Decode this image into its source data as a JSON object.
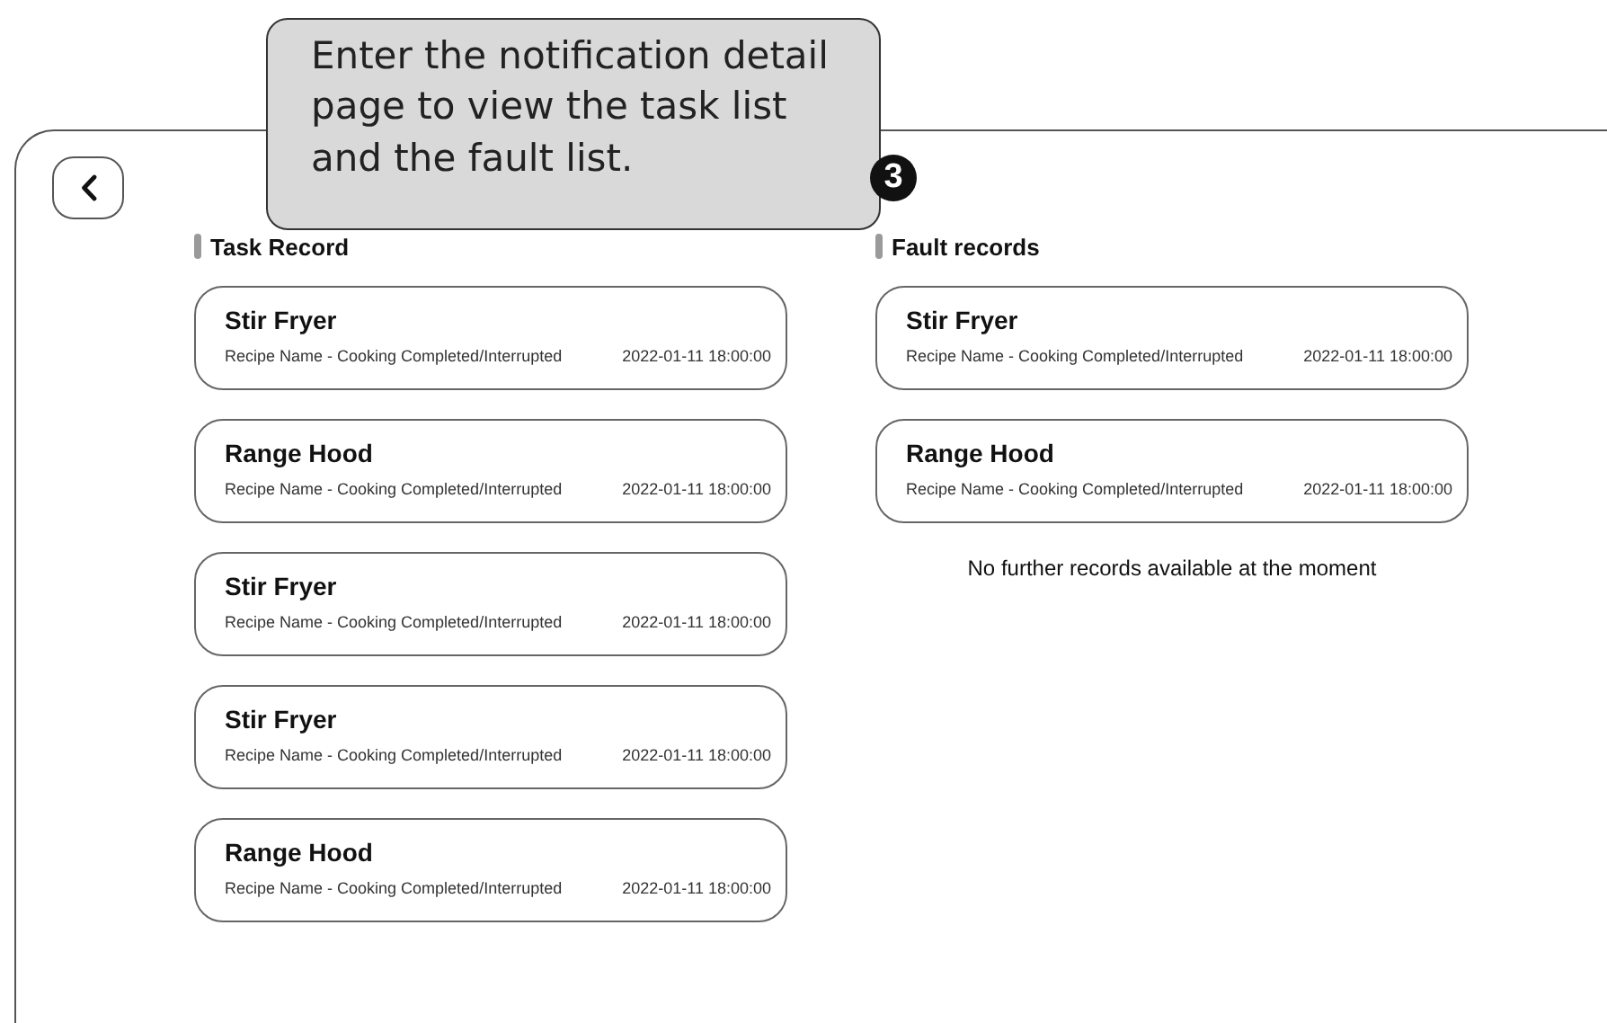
{
  "callout": {
    "text": "Enter the notification detail page to view the task list and the fault list.",
    "step": "3"
  },
  "task_record": {
    "title": "Task Record",
    "items": [
      {
        "title": "Stir Fryer",
        "subtitle": "Recipe Name - Cooking Completed/Interrupted",
        "time": "2022-01-11 18:00:00"
      },
      {
        "title": "Range Hood",
        "subtitle": "Recipe Name - Cooking Completed/Interrupted",
        "time": "2022-01-11 18:00:00"
      },
      {
        "title": "Stir Fryer",
        "subtitle": "Recipe Name - Cooking Completed/Interrupted",
        "time": "2022-01-11 18:00:00"
      },
      {
        "title": "Stir Fryer",
        "subtitle": "Recipe Name - Cooking Completed/Interrupted",
        "time": "2022-01-11 18:00:00"
      },
      {
        "title": "Range Hood",
        "subtitle": "Recipe Name - Cooking Completed/Interrupted",
        "time": "2022-01-11 18:00:00"
      }
    ]
  },
  "fault_records": {
    "title": "Fault records",
    "items": [
      {
        "title": "Stir Fryer",
        "subtitle": "Recipe Name - Cooking Completed/Interrupted",
        "time": "2022-01-11 18:00:00"
      },
      {
        "title": "Range Hood",
        "subtitle": "Recipe Name - Cooking Completed/Interrupted",
        "time": "2022-01-11 18:00:00"
      }
    ],
    "empty_message": "No further records available at the moment"
  }
}
